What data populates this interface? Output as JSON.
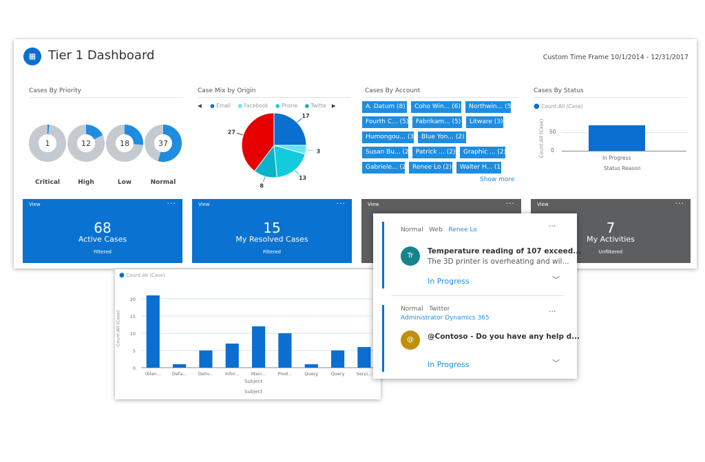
{
  "header": {
    "title": "Tier 1 Dashboard",
    "time_frame": "Custom Time Frame 10/1/2014 - 12/31/2017"
  },
  "colors": {
    "accent": "#0a6fd0",
    "tile_blue": "#0a72d1",
    "tile_grey": "#5d5e60",
    "donut_fill": "#1e8de0",
    "donut_track": "#c5cad1"
  },
  "priority": {
    "title": "Cases By Priority",
    "items": [
      {
        "label": "Critical",
        "value": 1
      },
      {
        "label": "High",
        "value": 12
      },
      {
        "label": "Low",
        "value": 18
      },
      {
        "label": "Normal",
        "value": 37
      }
    ],
    "total": 68
  },
  "origin": {
    "title": "Case Mix by Origin",
    "legend": [
      "Email",
      "Facebook",
      "Phone",
      "Twitte"
    ],
    "slices": [
      {
        "name": "Email",
        "value": 17,
        "color": "#0a6fd0"
      },
      {
        "name": "Facebook",
        "value": 3,
        "color": "#5fe6f5"
      },
      {
        "name": "Phone",
        "value": 13,
        "color": "#12cbdc"
      },
      {
        "name": "Twitter",
        "value": 8,
        "color": "#0ab3c9"
      },
      {
        "name": "",
        "value": 27,
        "color": "#e60000"
      }
    ]
  },
  "account": {
    "title": "Cases By Account",
    "tags": [
      "A. Datum (8)",
      "Coho Win... (6)",
      "Northwin... (5)",
      "Fourth C... (5)",
      "Fabrikam... (5)",
      "Litware (3)",
      "Humongou... (3)",
      "Blue Yon... (2)",
      "Susan Bu... (2)",
      "Patrick ... (2)",
      "Graphic ... (2)",
      "Gabriele... (2)",
      "Renee Lo (2)",
      "Walter H... (1)"
    ],
    "show_more": "Show more"
  },
  "status": {
    "title": "Cases By Status",
    "legend": "Count:All (Case)",
    "ylabel": "Count:All (Case)",
    "xlabel": "Status Reason",
    "category": "In Progress",
    "value": 68,
    "ticks": [
      "50",
      "0"
    ]
  },
  "tiles": [
    {
      "view": "View",
      "dots": "···",
      "value": "68",
      "label": "Active Cases",
      "sub": "Filtered"
    },
    {
      "view": "View",
      "dots": "···",
      "value": "15",
      "label": "My Resolved Cases",
      "sub": "Filtered"
    },
    {
      "view": "View",
      "dots": "···"
    },
    {
      "view": "View",
      "dots": "···",
      "value": "7",
      "label": "My Activities",
      "sub": "Unfiltered"
    }
  ],
  "chart_data": {
    "type": "bar",
    "legend": "Count:All (Case)",
    "ylabel": "Count:All (Case)",
    "xlabel": "Subject",
    "xlabel2": "Subject",
    "categories": [
      "(blan...",
      "Defa...",
      "Deliv...",
      "Infor...",
      "Main...",
      "Prod...",
      "Query",
      "Query",
      "Servi..."
    ],
    "values": [
      21,
      1,
      5,
      7,
      12,
      10,
      1,
      5,
      6
    ],
    "ylim": [
      0,
      20
    ],
    "yticks": [
      0,
      5,
      10,
      15,
      20
    ],
    "grid": true
  },
  "cards": [
    {
      "priority": "Normal",
      "origin": "Web",
      "owner": "Renee Lo",
      "initials": "Tr",
      "avatar_color": "#16838a",
      "title": "Temperature reading of 107 exceed...",
      "desc": "The 3D printer is overheating and wil...",
      "status": "In Progress",
      "dots": "···"
    },
    {
      "priority": "Normal",
      "origin": "Twitter",
      "owner": "Administrator Dynamics 365",
      "initials": "@",
      "avatar_color": "#c08f0b",
      "title": "@Contoso - Do you have any help d...",
      "status": "In Progress",
      "dots": "···"
    }
  ]
}
